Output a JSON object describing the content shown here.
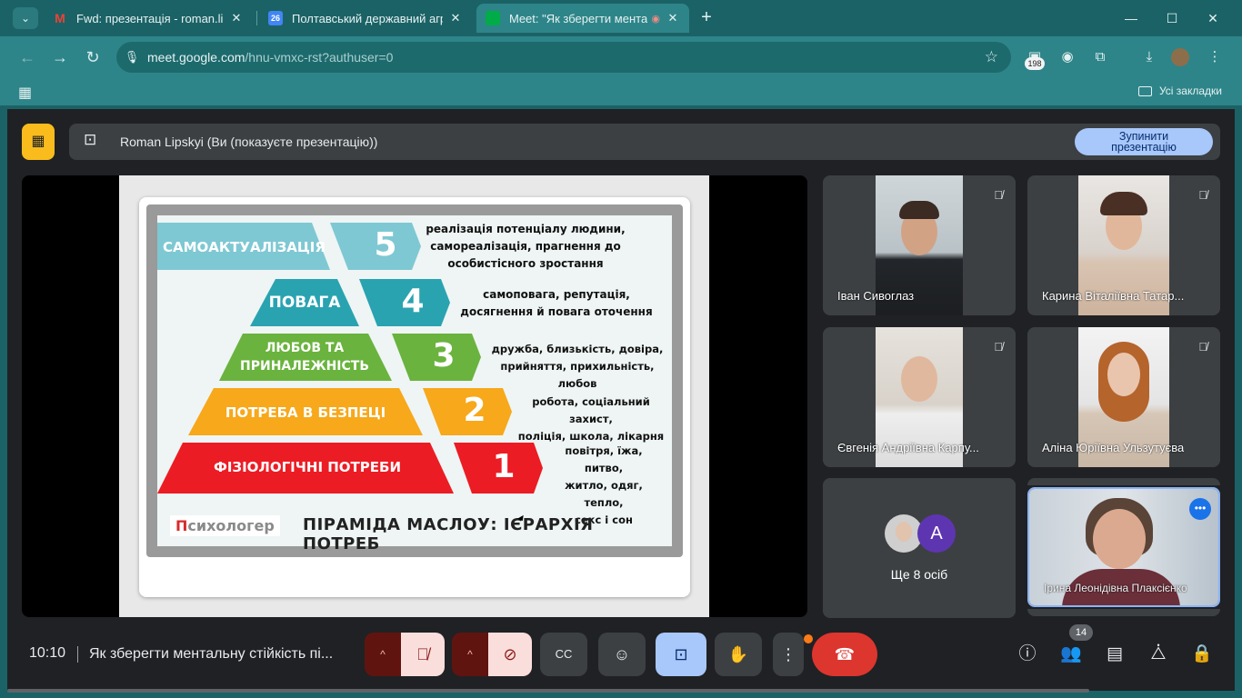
{
  "tabs": [
    {
      "title": "Fwd: презентація - roman.lipsk",
      "icon": "gmail-icon",
      "color": "#ea4335"
    },
    {
      "title": "Полтавський державний аграр",
      "icon": "calendar-icon",
      "color": "#4285f4",
      "icon_text": "26"
    },
    {
      "title": "Meet: \"Як зберегти ментал",
      "icon": "meet-icon",
      "color": "#00ac47"
    }
  ],
  "url": {
    "host": "meet.google.com",
    "path": "/hnu-vmxc-rst?authuser=0"
  },
  "extension_badge": "198",
  "bookmarks_label": "Усі закладки",
  "presenting": {
    "text": "Roman Lipskyi (Ви (показуєте презентацію))",
    "stop_label_1": "Зупинити",
    "stop_label_2": "презентацію"
  },
  "slide": {
    "tiers": [
      {
        "label": "САМОАКТУАЛІЗАЦІЯ",
        "num": "5",
        "color": "#7ec8d3",
        "desc": [
          "реалізація потенціалу людини,",
          "самореалізація, прагнення до",
          "особистісного зростання"
        ]
      },
      {
        "label": "ПОВАГА",
        "num": "4",
        "color": "#2aa3b1",
        "desc": [
          "самоповага, репутація,",
          "досягнення й повага оточення"
        ]
      },
      {
        "label_1": "ЛЮБОВ ТА",
        "label_2": "ПРИНАЛЕЖНІСТЬ",
        "num": "3",
        "color": "#6ab33e",
        "desc": [
          "дружба, близькість, довіра,",
          "прийняття, прихильність, любов"
        ]
      },
      {
        "label": "ПОТРЕБА В БЕЗПЕЦІ",
        "num": "2",
        "color": "#f7a81b",
        "desc": [
          "робота, соціальний захист,",
          "поліція, школа, лікарня"
        ]
      },
      {
        "label": "ФІЗІОЛОГІЧНІ ПОТРЕБИ",
        "num": "1",
        "color": "#ec1c24",
        "desc": [
          "повітря, їжа, питво,",
          "житло, одяг, тепло,",
          "секс і сон"
        ]
      }
    ],
    "brand_p": "П",
    "brand_rest": "сихологер",
    "title": "ПІРАМІДА МАСЛОУ: ІЄРАРХІЯ ПОТРЕБ"
  },
  "participants": [
    {
      "name": "Іван Сивоглаз"
    },
    {
      "name": "Карина Віталіївна Татар..."
    },
    {
      "name": "Євгенія Андріївна Карпу..."
    },
    {
      "name": "Аліна Юріївна Ульзутуєва"
    }
  ],
  "more": {
    "avatar_letter": "A",
    "label": "Ще 8 осіб"
  },
  "self": {
    "name": "Ірина Леонідівна Плаксієнко"
  },
  "bottom": {
    "time": "10:10",
    "meeting_title": "Як зберегти ментальну стійкість пі...",
    "people_count": "14"
  }
}
